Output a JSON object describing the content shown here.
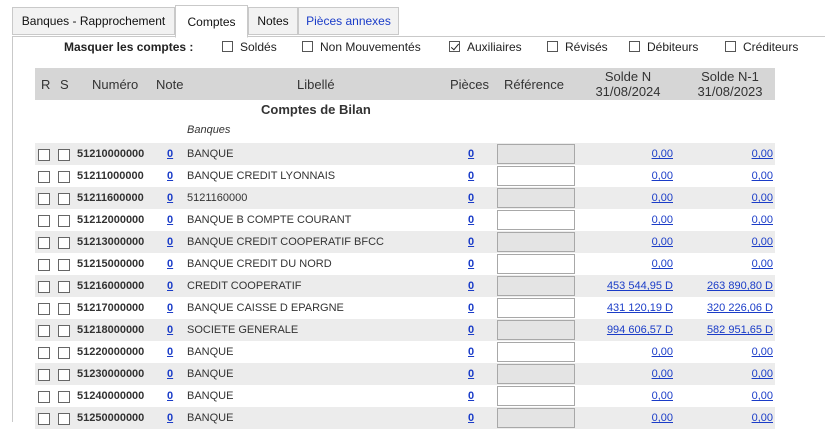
{
  "tabs": [
    {
      "label": "Banques - Rapprochement",
      "active": false
    },
    {
      "label": "Comptes",
      "active": true
    },
    {
      "label": "Notes",
      "active": false
    },
    {
      "label": "Pièces annexes",
      "active": false
    }
  ],
  "filters": {
    "label": "Masquer les comptes :",
    "options": [
      {
        "label": "Soldés",
        "checked": false
      },
      {
        "label": "Non Mouvementés",
        "checked": false
      },
      {
        "label": "Auxiliaires",
        "checked": true
      },
      {
        "label": "Révisés",
        "checked": false
      },
      {
        "label": "Débiteurs",
        "checked": false
      },
      {
        "label": "Créditeurs",
        "checked": false
      }
    ]
  },
  "table": {
    "headers": {
      "r": "R",
      "s": "S",
      "numero": "Numéro",
      "note": "Note",
      "libelle": "Libellé",
      "pieces": "Pièces",
      "reference": "Référence",
      "solde_n": "Solde N",
      "solde_n_date": "31/08/2024",
      "solde_n1": "Solde N-1",
      "solde_n1_date": "31/08/2023"
    },
    "section_title": "Comptes de Bilan",
    "group_label": "Banques",
    "rows": [
      {
        "numero": "51210000000",
        "note": "0",
        "libelle": "BANQUE",
        "pieces": "0",
        "solde_n": "0,00",
        "solde_n1": "0,00"
      },
      {
        "numero": "51211000000",
        "note": "0",
        "libelle": "BANQUE CREDIT LYONNAIS",
        "pieces": "0",
        "solde_n": "0,00",
        "solde_n1": "0,00"
      },
      {
        "numero": "51211600000",
        "note": "0",
        "libelle": "5121160000",
        "pieces": "0",
        "solde_n": "0,00",
        "solde_n1": "0,00"
      },
      {
        "numero": "51212000000",
        "note": "0",
        "libelle": "BANQUE B COMPTE COURANT",
        "pieces": "0",
        "solde_n": "0,00",
        "solde_n1": "0,00"
      },
      {
        "numero": "51213000000",
        "note": "0",
        "libelle": "BANQUE CREDIT COOPERATIF BFCC",
        "pieces": "0",
        "solde_n": "0,00",
        "solde_n1": "0,00"
      },
      {
        "numero": "51215000000",
        "note": "0",
        "libelle": "BANQUE CREDIT DU NORD",
        "pieces": "0",
        "solde_n": "0,00",
        "solde_n1": "0,00"
      },
      {
        "numero": "51216000000",
        "note": "0",
        "libelle": "CREDIT COOPERATIF",
        "pieces": "0",
        "solde_n": "453 544,95 D",
        "solde_n1": "263 890,80 D"
      },
      {
        "numero": "51217000000",
        "note": "0",
        "libelle": "BANQUE CAISSE D EPARGNE",
        "pieces": "0",
        "solde_n": "431 120,19 D",
        "solde_n1": "320 226,06 D"
      },
      {
        "numero": "51218000000",
        "note": "0",
        "libelle": "SOCIETE GENERALE",
        "pieces": "0",
        "solde_n": "994 606,57 D",
        "solde_n1": "582 951,65 D"
      },
      {
        "numero": "51220000000",
        "note": "0",
        "libelle": "BANQUE",
        "pieces": "0",
        "solde_n": "0,00",
        "solde_n1": "0,00"
      },
      {
        "numero": "51230000000",
        "note": "0",
        "libelle": "BANQUE",
        "pieces": "0",
        "solde_n": "0,00",
        "solde_n1": "0,00"
      },
      {
        "numero": "51240000000",
        "note": "0",
        "libelle": "BANQUE",
        "pieces": "0",
        "solde_n": "0,00",
        "solde_n1": "0,00"
      },
      {
        "numero": "51250000000",
        "note": "0",
        "libelle": "BANQUE",
        "pieces": "0",
        "solde_n": "0,00",
        "solde_n1": "0,00"
      }
    ]
  }
}
